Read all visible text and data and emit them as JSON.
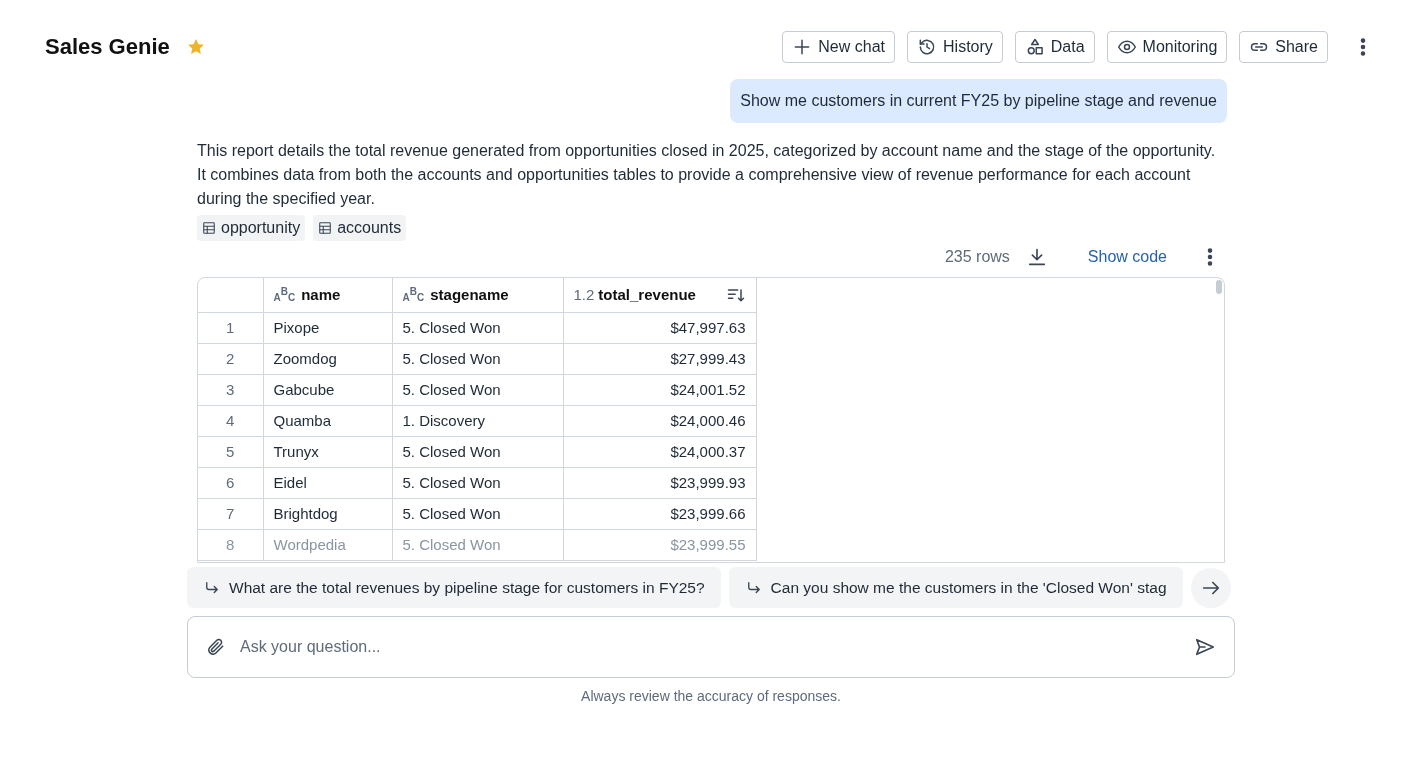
{
  "header": {
    "title": "Sales Genie",
    "starred": true,
    "buttons": [
      {
        "label": "New chat"
      },
      {
        "label": "History"
      },
      {
        "label": "Data"
      },
      {
        "label": "Monitoring"
      },
      {
        "label": "Share"
      }
    ]
  },
  "user_message": "Show me customers in current FY25 by pipeline stage and revenue",
  "answer": {
    "text": "This report details the total revenue generated from opportunities closed in 2025, categorized by account name and the stage of the opportunity. It combines data from both the accounts and opportunities tables to provide a comprehensive view of revenue performance for each account during the specified year.",
    "tables": [
      "opportunity",
      "accounts"
    ]
  },
  "result": {
    "row_count": "235 rows",
    "show_code": "Show code",
    "columns": [
      {
        "name": "name",
        "type": "ABC",
        "kind": "text",
        "sort": false
      },
      {
        "name": "stagename",
        "type": "ABC",
        "kind": "text",
        "sort": false
      },
      {
        "name": "total_revenue",
        "type": "1.2",
        "kind": "number",
        "sort": true
      }
    ],
    "rows": [
      {
        "index": "1",
        "cells": [
          "Pixope",
          "5. Closed Won",
          "$47,997.63"
        ]
      },
      {
        "index": "2",
        "cells": [
          "Zoomdog",
          "5. Closed Won",
          "$27,999.43"
        ]
      },
      {
        "index": "3",
        "cells": [
          "Gabcube",
          "5. Closed Won",
          "$24,001.52"
        ]
      },
      {
        "index": "4",
        "cells": [
          "Quamba",
          "1. Discovery",
          "$24,000.46"
        ]
      },
      {
        "index": "5",
        "cells": [
          "Trunyx",
          "5. Closed Won",
          "$24,000.37"
        ]
      },
      {
        "index": "6",
        "cells": [
          "Eidel",
          "5. Closed Won",
          "$23,999.93"
        ]
      },
      {
        "index": "7",
        "cells": [
          "Brightdog",
          "5. Closed Won",
          "$23,999.66"
        ]
      },
      {
        "index": "8",
        "cells": [
          "Wordpedia",
          "5. Closed Won",
          "$23,999.55"
        ]
      }
    ]
  },
  "suggestions": [
    "What are the total revenues by pipeline stage for customers in FY25?",
    "Can you show me the customers in the 'Closed Won' stag"
  ],
  "input": {
    "placeholder": "Ask your question..."
  },
  "disclaimer": "Always review the accuracy of responses."
}
